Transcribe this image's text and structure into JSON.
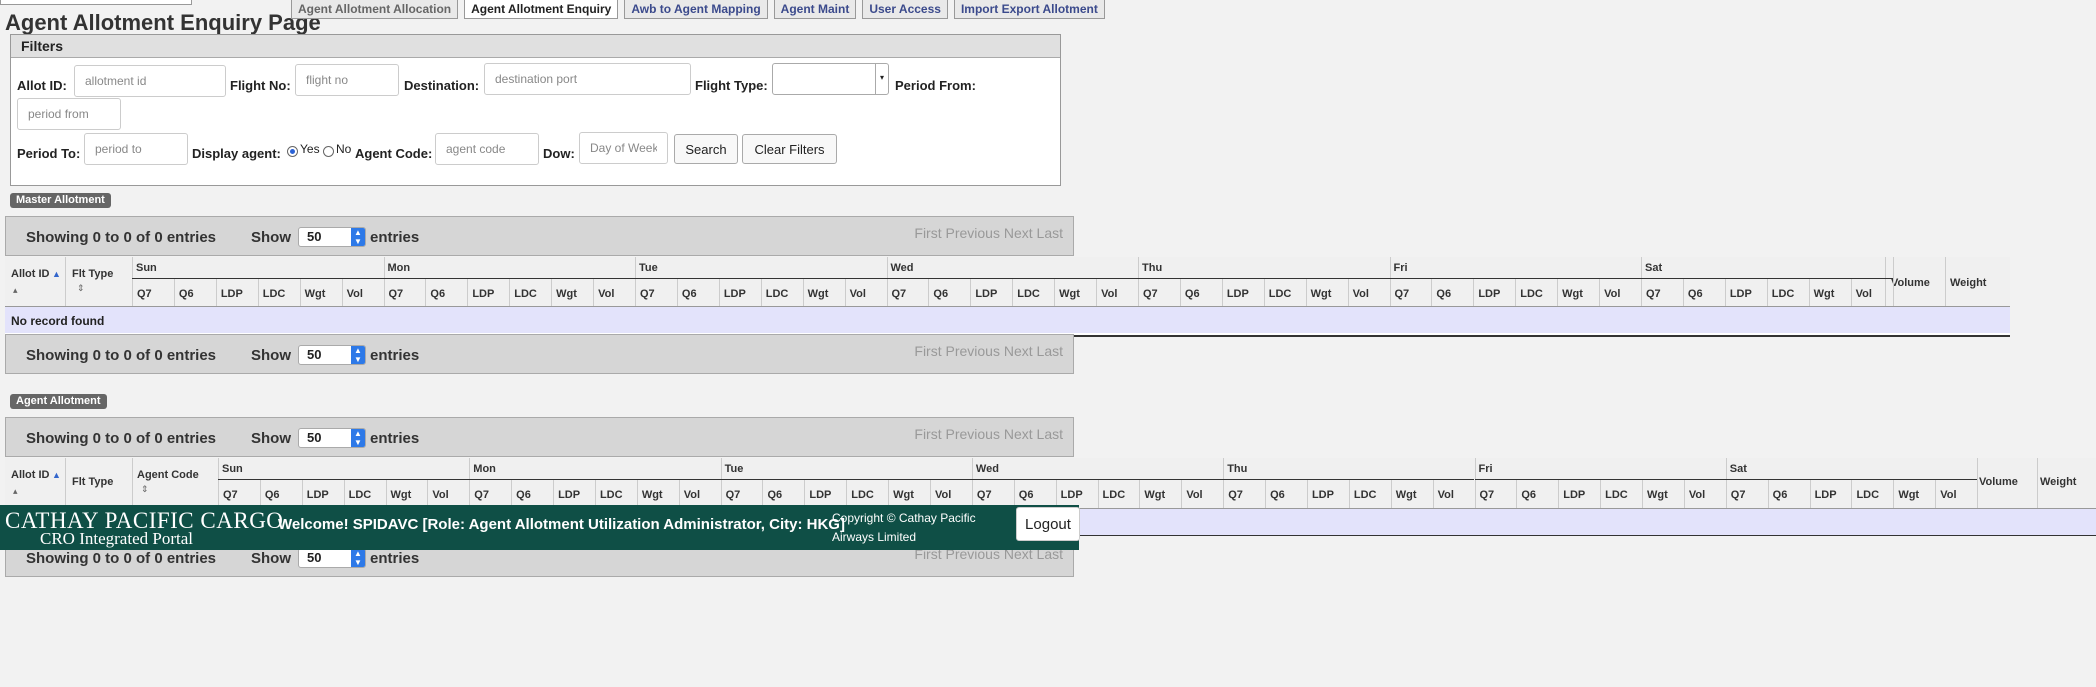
{
  "page_title": "Agent Allotment Enquiry Page",
  "tabs": [
    {
      "label": "Agent Allotment Allocation"
    },
    {
      "label": "Agent Allotment Enquiry"
    },
    {
      "label": "Awb to Agent Mapping"
    },
    {
      "label": "Agent Maint"
    },
    {
      "label": "User Access"
    },
    {
      "label": "Import Export Allotment"
    }
  ],
  "filters": {
    "title": "Filters",
    "allot_id": {
      "label": "Allot ID:",
      "placeholder": "allotment id"
    },
    "flight_no": {
      "label": "Flight No:",
      "placeholder": "flight no"
    },
    "destination": {
      "label": "Destination:",
      "placeholder": "destination port"
    },
    "flight_type": {
      "label": "Flight Type:",
      "value": ""
    },
    "period_from": {
      "label": "Period From:",
      "placeholder": "period from"
    },
    "period_to": {
      "label": "Period To:",
      "placeholder": "period to"
    },
    "display_agent": {
      "label": "Display agent:",
      "yes": "Yes",
      "no": "No",
      "selected": "Yes"
    },
    "agent_code": {
      "label": "Agent Code:",
      "placeholder": "agent code"
    },
    "dow": {
      "label": "Dow:",
      "placeholder": "Day of Week"
    },
    "search_label": "Search",
    "clear_label": "Clear Filters"
  },
  "master": {
    "badge": "Master Allotment",
    "info_top": "Showing 0 to 0 of 0 entries",
    "info_bottom": "Showing 0 to 0 of 0 entries",
    "columns": {
      "allot_id": "Allot ID",
      "flt_type": "Flt Type",
      "volume": "Volume",
      "weight": "Weight"
    },
    "no_record": "No record found"
  },
  "agent": {
    "badge": "Agent Allotment",
    "info_top": "Showing 0 to 0 of 0 entries",
    "info_bottom": "Showing 0 to 0 of 0 entries",
    "columns": {
      "allot_id": "Allot ID",
      "flt_type": "Flt Type",
      "agent_code": "Agent Code",
      "volume": "Volume",
      "weight": "Weight"
    }
  },
  "days": [
    "Sun",
    "Mon",
    "Tue",
    "Wed",
    "Thu",
    "Fri",
    "Sat"
  ],
  "sub_columns": [
    "Q7",
    "Q6",
    "LDP",
    "LDC",
    "Wgt",
    "Vol"
  ],
  "table_controls": {
    "show": "Show",
    "entries": "entries",
    "page_length": "50",
    "pager": "First Previous Next Last"
  },
  "footer": {
    "brand_line1": "CATHAY PACIFIC CARGO",
    "brand_line2": "CRO Integrated Portal",
    "welcome": "Welcome! SPIDAVC [Role: Agent Allotment Utilization Administrator, City: HKG]",
    "copyright": "Copyright © Cathay Pacific Airways Limited",
    "logout_label": "Logout"
  },
  "colors": {
    "footer_bg": "#0f4f46",
    "no_record_row": "#e3e3fb",
    "length_spinner": "#2d79e8",
    "active_tab": "#ffffff"
  }
}
